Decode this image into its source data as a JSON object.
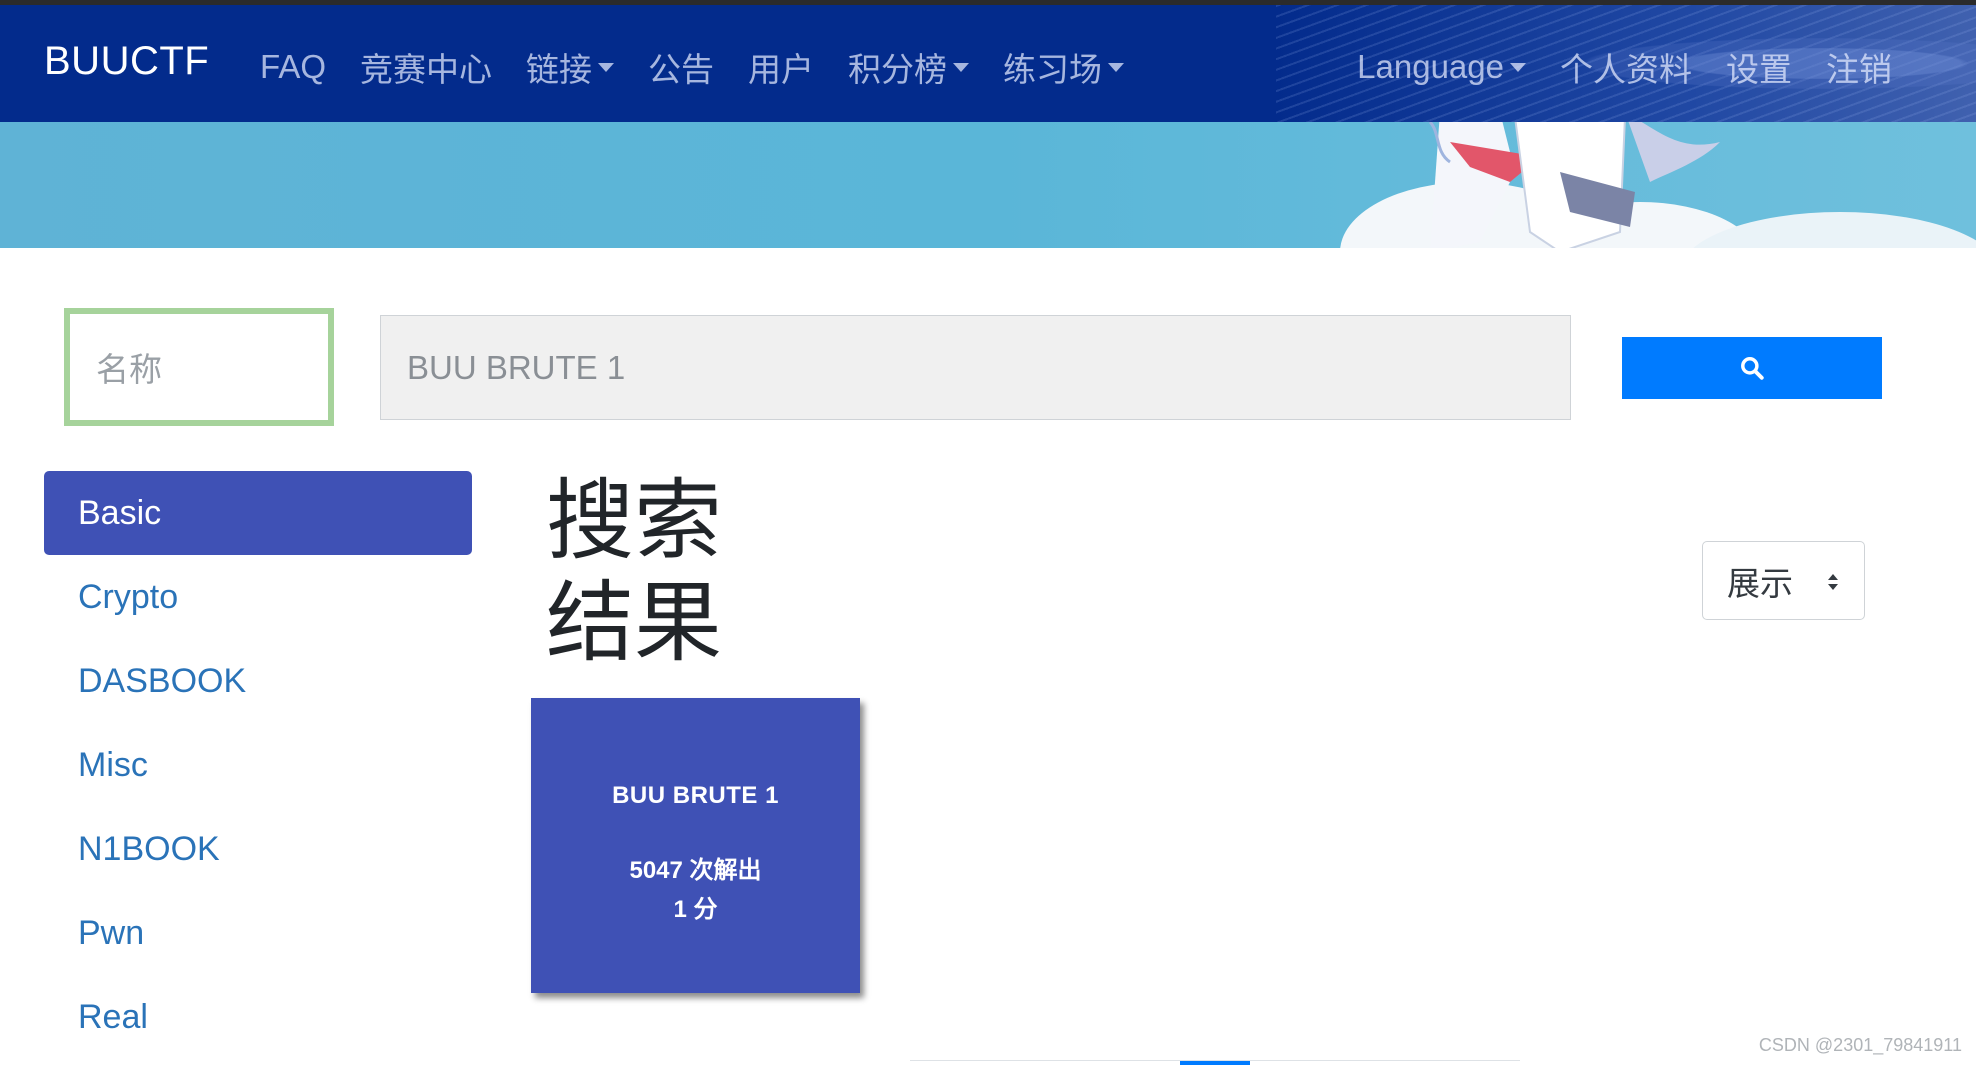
{
  "navbar": {
    "brand": "BUUCTF",
    "left_items": [
      {
        "label": "FAQ",
        "dropdown": false
      },
      {
        "label": "竞赛中心",
        "dropdown": false
      },
      {
        "label": "链接",
        "dropdown": true
      },
      {
        "label": "公告",
        "dropdown": false
      },
      {
        "label": "用户",
        "dropdown": false
      },
      {
        "label": "积分榜",
        "dropdown": true
      },
      {
        "label": "练习场",
        "dropdown": true
      }
    ],
    "right_items": [
      {
        "label": "Language",
        "dropdown": true
      },
      {
        "label": "个人资料",
        "dropdown": false
      },
      {
        "label": "设置",
        "dropdown": false
      },
      {
        "label": "注销",
        "dropdown": false
      }
    ]
  },
  "search": {
    "field_placeholder": "名称",
    "query_placeholder": "BUU BRUTE 1",
    "button_icon": "search-icon"
  },
  "sidebar": {
    "items": [
      {
        "label": "Basic",
        "active": true
      },
      {
        "label": "Crypto",
        "active": false
      },
      {
        "label": "DASBOOK",
        "active": false
      },
      {
        "label": "Misc",
        "active": false
      },
      {
        "label": "N1BOOK",
        "active": false
      },
      {
        "label": "Pwn",
        "active": false
      },
      {
        "label": "Real",
        "active": false
      }
    ]
  },
  "results": {
    "title": "搜索结果",
    "display_select": "展示",
    "cards": [
      {
        "name": "BUU BRUTE 1",
        "solves": "5047 次解出",
        "points": "1 分"
      }
    ]
  },
  "watermark": "CSDN @2301_79841911",
  "colors": {
    "navbar": "#032b8c",
    "accent": "#3f51b5",
    "primary_button": "#007bff",
    "link": "#2a73b8"
  }
}
